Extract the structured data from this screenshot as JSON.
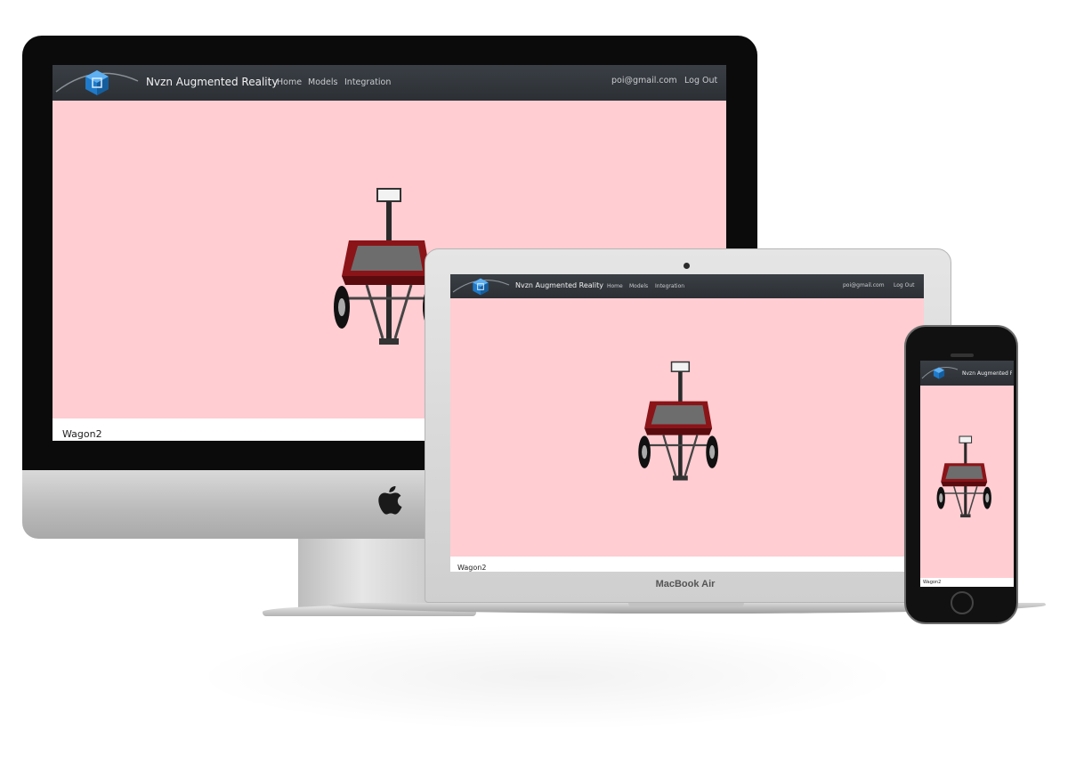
{
  "app": {
    "brand": "Nvzn Augmented Reality",
    "nav_links": [
      "Home",
      "Models",
      "Integration"
    ],
    "user_email": "poi@gmail.com",
    "logout_label": "Log Out",
    "model_name": "Wagon2"
  },
  "devices": {
    "laptop_label": "MacBook Air"
  },
  "colors": {
    "navbar": "#2c3035",
    "viewer_background": "#ffcdd2",
    "logo_blue": "#1f7ac9",
    "wagon_red": "#8b1418"
  },
  "icons": {
    "logo": "cube-logo-icon",
    "apple": "apple-logo-icon"
  }
}
